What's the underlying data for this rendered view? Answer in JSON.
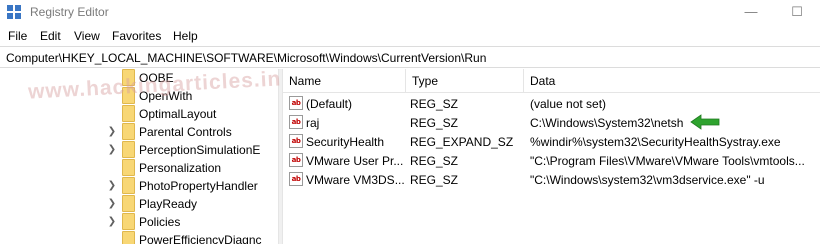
{
  "window": {
    "title": "Registry Editor",
    "icon": "registry-editor-icon",
    "minimize_glyph": "—",
    "maximize_glyph": "☐"
  },
  "menu": [
    "File",
    "Edit",
    "View",
    "Favorites",
    "Help"
  ],
  "address": "Computer\\HKEY_LOCAL_MACHINE\\SOFTWARE\\Microsoft\\Windows\\CurrentVersion\\Run",
  "tree": {
    "items": [
      {
        "label": "OOBE",
        "expandable": false
      },
      {
        "label": "OpenWith",
        "expandable": false
      },
      {
        "label": "OptimalLayout",
        "expandable": false
      },
      {
        "label": "Parental Controls",
        "expandable": true
      },
      {
        "label": "PerceptionSimulationE",
        "expandable": true
      },
      {
        "label": "Personalization",
        "expandable": false
      },
      {
        "label": "PhotoPropertyHandler",
        "expandable": true
      },
      {
        "label": "PlayReady",
        "expandable": true
      },
      {
        "label": "Policies",
        "expandable": true
      },
      {
        "label": "PowerEfficiencyDiagnc",
        "expandable": false
      }
    ]
  },
  "columns": {
    "name": "Name",
    "type": "Type",
    "data": "Data"
  },
  "values": [
    {
      "name": "(Default)",
      "type": "REG_SZ",
      "data": "(value not set)"
    },
    {
      "name": "raj",
      "type": "REG_SZ",
      "data": "C:\\Windows\\System32\\netsh"
    },
    {
      "name": "SecurityHealth",
      "type": "REG_EXPAND_SZ",
      "data": "%windir%\\system32\\SecurityHealthSystray.exe"
    },
    {
      "name": "VMware User Pr...",
      "type": "REG_SZ",
      "data": "\"C:\\Program Files\\VMware\\VMware Tools\\vmtools..."
    },
    {
      "name": "VMware VM3DS...",
      "type": "REG_SZ",
      "data": "\"C:\\Windows\\system32\\vm3dservice.exe\" -u"
    }
  ],
  "value_icon_text": "ab",
  "annotation": {
    "icon": "green-arrow-icon",
    "color": "#2ea32e"
  },
  "watermark": "www.hackingarticles.in"
}
